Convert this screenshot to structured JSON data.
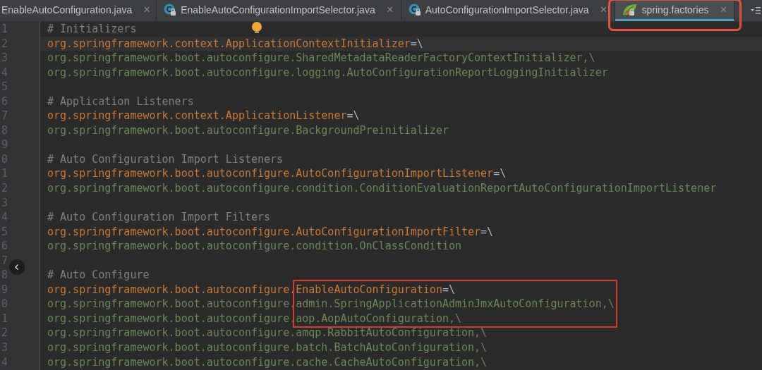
{
  "tabs": [
    {
      "label": "EnableAutoConfiguration.java",
      "close": "×",
      "kind": "plain",
      "selected": false
    },
    {
      "label": "EnableAutoConfigurationImportSelector.java",
      "close": "×",
      "kind": "class",
      "selected": false
    },
    {
      "label": "AutoConfigurationImportSelector.java",
      "close": "×",
      "kind": "class",
      "selected": false
    },
    {
      "label": "spring.factories",
      "close": "×",
      "kind": "spring",
      "selected": true,
      "highlighted": true
    }
  ],
  "lines": [
    {
      "number": "1",
      "segments": [
        {
          "text": "# Initializers",
          "kind": "comment"
        }
      ]
    },
    {
      "number": "2",
      "current": true,
      "segments": [
        {
          "text": "org.springframework.context.ApplicationContextInitializer",
          "kind": "key"
        },
        {
          "text": "=\\",
          "kind": "op"
        }
      ]
    },
    {
      "number": "3",
      "segments": [
        {
          "text": "org.springframework.boot.autoconfigure.SharedMetadataReaderFactoryContextInitializer,\\",
          "kind": "value"
        }
      ]
    },
    {
      "number": "4",
      "segments": [
        {
          "text": "org.springframework.boot.autoconfigure.logging.AutoConfigurationReportLoggingInitializer",
          "kind": "value"
        }
      ]
    },
    {
      "number": "5"
    },
    {
      "number": "6",
      "segments": [
        {
          "text": "# Application Listeners",
          "kind": "comment"
        }
      ]
    },
    {
      "number": "7",
      "segments": [
        {
          "text": "org.springframework.context.ApplicationListener",
          "kind": "key"
        },
        {
          "text": "=\\",
          "kind": "op"
        }
      ]
    },
    {
      "number": "8",
      "segments": [
        {
          "text": "org.springframework.boot.autoconfigure.BackgroundPreinitializer",
          "kind": "value"
        }
      ]
    },
    {
      "number": "9"
    },
    {
      "number": "0",
      "segments": [
        {
          "text": "# Auto Configuration Import Listeners",
          "kind": "comment"
        }
      ]
    },
    {
      "number": "1",
      "segments": [
        {
          "text": "org.springframework.boot.autoconfigure.AutoConfigurationImportListener",
          "kind": "key"
        },
        {
          "text": "=\\",
          "kind": "op"
        }
      ]
    },
    {
      "number": "2",
      "segments": [
        {
          "text": "org.springframework.boot.autoconfigure.condition.ConditionEvaluationReportAutoConfigurationImportListener",
          "kind": "value"
        }
      ]
    },
    {
      "number": "3"
    },
    {
      "number": "4",
      "segments": [
        {
          "text": "# Auto Configuration Import Filters",
          "kind": "comment"
        }
      ]
    },
    {
      "number": "5",
      "segments": [
        {
          "text": "org.springframework.boot.autoconfigure.AutoConfigurationImportFilter",
          "kind": "key"
        },
        {
          "text": "=\\",
          "kind": "op"
        }
      ]
    },
    {
      "number": "6",
      "segments": [
        {
          "text": "org.springframework.boot.autoconfigure.condition.OnClassCondition",
          "kind": "value"
        }
      ]
    },
    {
      "number": "7"
    },
    {
      "number": "8",
      "segments": [
        {
          "text": "# Auto Configure",
          "kind": "comment"
        }
      ]
    },
    {
      "number": "9",
      "segments": [
        {
          "text": "org.springframework.boot.autoconfigure.",
          "kind": "key"
        },
        {
          "text": "EnableAutoConfiguration",
          "kind": "key",
          "boxed": true
        },
        {
          "text": "=\\",
          "kind": "op",
          "boxed": true
        }
      ]
    },
    {
      "number": "0",
      "segments": [
        {
          "text": "org.springframework.boot.autoconfigure.",
          "kind": "value"
        },
        {
          "text": "admin.SpringApplicationAdminJmxAutoConfiguration,\\",
          "kind": "value",
          "boxed": true
        }
      ]
    },
    {
      "number": "1",
      "segments": [
        {
          "text": "org.springframework.boot.autoconfigure.",
          "kind": "value"
        },
        {
          "text": "aop.AopAutoConfiguration,\\",
          "kind": "value",
          "boxed": true
        }
      ]
    },
    {
      "number": "2",
      "segments": [
        {
          "text": "org.springframework.boot.autoconfigure.amqp.RabbitAutoConfiguration,\\",
          "kind": "value"
        }
      ]
    },
    {
      "number": "3",
      "segments": [
        {
          "text": "org.springframework.boot.autoconfigure.batch.BatchAutoConfiguration,\\",
          "kind": "value"
        }
      ]
    },
    {
      "number": "4",
      "segments": [
        {
          "text": "org.springframework.boot.autoconfigure.cache.CacheAutoConfiguration,\\",
          "kind": "value"
        }
      ]
    }
  ]
}
